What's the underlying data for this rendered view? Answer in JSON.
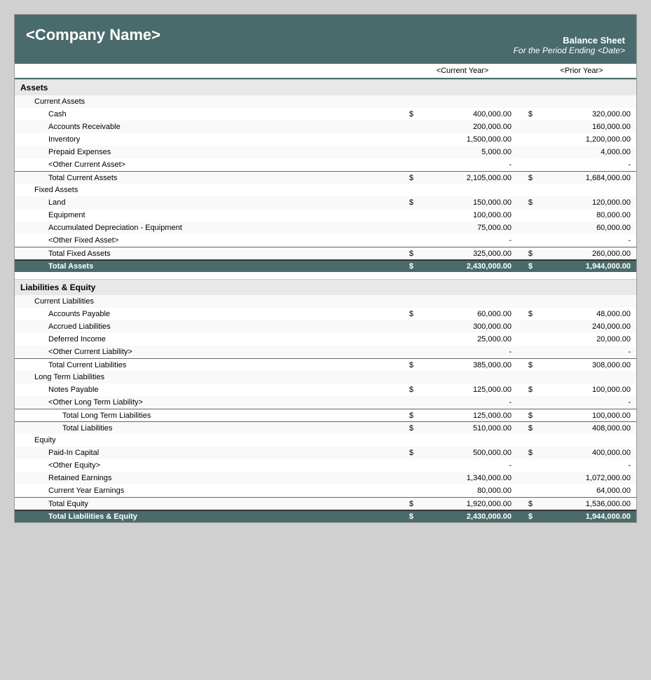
{
  "header": {
    "company": "<Company Name>",
    "title": "Balance Sheet",
    "subtitle": "For the Period Ending <Date>"
  },
  "columns": {
    "current_year": "<Current Year>",
    "prior_year": "<Prior Year>"
  },
  "assets": {
    "label": "Assets",
    "current_assets": {
      "label": "Current Assets",
      "items": [
        {
          "label": "Cash",
          "dollar": "$",
          "current": "400,000.00",
          "prior_dollar": "$",
          "prior": "320,000.00"
        },
        {
          "label": "Accounts Receivable",
          "dollar": "",
          "current": "200,000.00",
          "prior_dollar": "",
          "prior": "160,000.00"
        },
        {
          "label": "Inventory",
          "dollar": "",
          "current": "1,500,000.00",
          "prior_dollar": "",
          "prior": "1,200,000.00"
        },
        {
          "label": "Prepaid Expenses",
          "dollar": "",
          "current": "5,000.00",
          "prior_dollar": "",
          "prior": "4,000.00"
        },
        {
          "label": "<Other Current Asset>",
          "dollar": "",
          "current": "-",
          "prior_dollar": "",
          "prior": "-"
        }
      ],
      "total_label": "Total Current Assets",
      "total_dollar": "$",
      "total_current": "2,105,000.00",
      "total_prior_dollar": "$",
      "total_prior": "1,684,000.00"
    },
    "fixed_assets": {
      "label": "Fixed Assets",
      "items": [
        {
          "label": "Land",
          "dollar": "$",
          "current": "150,000.00",
          "prior_dollar": "$",
          "prior": "120,000.00"
        },
        {
          "label": "Equipment",
          "dollar": "",
          "current": "100,000.00",
          "prior_dollar": "",
          "prior": "80,000.00"
        },
        {
          "label": "Accumulated Depreciation - Equipment",
          "dollar": "",
          "current": "75,000.00",
          "prior_dollar": "",
          "prior": "60,000.00"
        },
        {
          "label": "<Other Fixed Asset>",
          "dollar": "",
          "current": "-",
          "prior_dollar": "",
          "prior": "-"
        }
      ],
      "total_label": "Total Fixed Assets",
      "total_dollar": "$",
      "total_current": "325,000.00",
      "total_prior_dollar": "$",
      "total_prior": "260,000.00"
    },
    "total_label": "Total Assets",
    "total_dollar": "$",
    "total_current": "2,430,000.00",
    "total_prior_dollar": "$",
    "total_prior": "1,944,000.00"
  },
  "liabilities": {
    "label": "Liabilities & Equity",
    "current_liabilities": {
      "label": "Current Liabilities",
      "items": [
        {
          "label": "Accounts Payable",
          "dollar": "$",
          "current": "60,000.00",
          "prior_dollar": "$",
          "prior": "48,000.00"
        },
        {
          "label": "Accrued Liabilities",
          "dollar": "",
          "current": "300,000.00",
          "prior_dollar": "",
          "prior": "240,000.00"
        },
        {
          "label": "Deferred Income",
          "dollar": "",
          "current": "25,000.00",
          "prior_dollar": "",
          "prior": "20,000.00"
        },
        {
          "label": "<Other Current Liability>",
          "dollar": "",
          "current": "-",
          "prior_dollar": "",
          "prior": "-"
        }
      ],
      "total_label": "Total Current Liabilities",
      "total_dollar": "$",
      "total_current": "385,000.00",
      "total_prior_dollar": "$",
      "total_prior": "308,000.00"
    },
    "long_term_liabilities": {
      "label": "Long Term Liabilities",
      "items": [
        {
          "label": "Notes Payable",
          "dollar": "$",
          "current": "125,000.00",
          "prior_dollar": "$",
          "prior": "100,000.00"
        },
        {
          "label": "<Other Long Term Liability>",
          "dollar": "",
          "current": "-",
          "prior_dollar": "",
          "prior": "-"
        }
      ],
      "total_lt_label": "Total Long Term Liabilities",
      "total_lt_dollar": "$",
      "total_lt_current": "125,000.00",
      "total_lt_prior_dollar": "$",
      "total_lt_prior": "100,000.00",
      "total_liab_label": "Total Liabilities",
      "total_liab_dollar": "$",
      "total_liab_current": "510,000.00",
      "total_liab_prior_dollar": "$",
      "total_liab_prior": "408,000.00"
    },
    "equity": {
      "label": "Equity",
      "items": [
        {
          "label": "Paid-In Capital",
          "dollar": "$",
          "current": "500,000.00",
          "prior_dollar": "$",
          "prior": "400,000.00"
        },
        {
          "label": "<Other Equity>",
          "dollar": "",
          "current": "-",
          "prior_dollar": "",
          "prior": "-"
        },
        {
          "label": "Retained Earnings",
          "dollar": "",
          "current": "1,340,000.00",
          "prior_dollar": "",
          "prior": "1,072,000.00"
        },
        {
          "label": "Current Year Earnings",
          "dollar": "",
          "current": "80,000.00",
          "prior_dollar": "",
          "prior": "64,000.00"
        }
      ],
      "total_label": "Total Equity",
      "total_dollar": "$",
      "total_current": "1,920,000.00",
      "total_prior_dollar": "$",
      "total_prior": "1,536,000.00"
    },
    "grand_total_label": "Total Liabilities & Equity",
    "grand_total_dollar": "$",
    "grand_total_current": "2,430,000.00",
    "grand_total_prior_dollar": "$",
    "grand_total_prior": "1,944,000.00"
  }
}
